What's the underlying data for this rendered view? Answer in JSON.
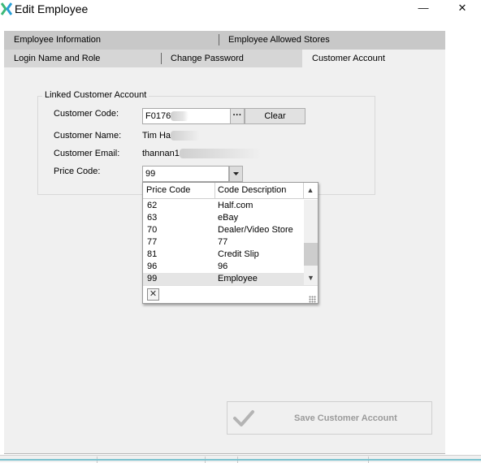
{
  "window": {
    "title": "Edit Employee",
    "minimize_glyph": "—",
    "close_glyph": "✕",
    "app_icon": "x-logo-icon",
    "app_icon_colors": [
      "#3cb878",
      "#2a9fd6"
    ]
  },
  "tabs": {
    "row1": [
      "Employee Information",
      "Employee Allowed Stores"
    ],
    "row2": [
      "Login Name and Role",
      "Change Password",
      "Customer Account"
    ],
    "active": "Customer Account"
  },
  "linked_account": {
    "legend": "Linked Customer Account",
    "customer_code_label": "Customer Code:",
    "customer_code_value": "F0176",
    "browse_button": "···",
    "clear_button": "Clear",
    "customer_name_label": "Customer Name:",
    "customer_name_value": "Tim Ha",
    "customer_email_label": "Customer Email:",
    "customer_email_value": "thannan1",
    "price_code_label": "Price Code:",
    "price_code_value": "99"
  },
  "price_code_dropdown": {
    "columns": [
      "Price Code",
      "Code Description"
    ],
    "rows": [
      {
        "code": "62",
        "description": "Half.com"
      },
      {
        "code": "63",
        "description": "eBay"
      },
      {
        "code": "70",
        "description": "Dealer/Video Store"
      },
      {
        "code": "77",
        "description": "77"
      },
      {
        "code": "81",
        "description": "Credit Slip"
      },
      {
        "code": "96",
        "description": "96"
      },
      {
        "code": "99",
        "description": "Employee"
      }
    ],
    "selected_code": "99",
    "close_glyph": "✕"
  },
  "footer": {
    "save_button": "Save Customer Account",
    "save_enabled": false
  },
  "colors": {
    "panel_bg": "#f0f0f0",
    "disabled_text": "#9b9b9b",
    "statusbar_accent": "#7cc3cf"
  }
}
